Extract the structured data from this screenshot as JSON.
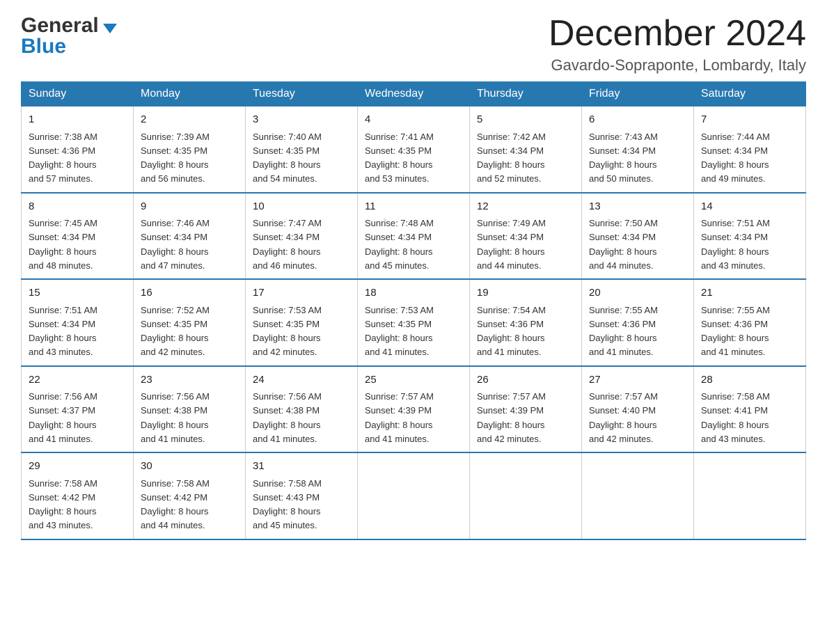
{
  "header": {
    "logo_general": "General",
    "logo_blue": "Blue",
    "month_title": "December 2024",
    "location": "Gavardo-Sopraponte, Lombardy, Italy"
  },
  "days_of_week": [
    "Sunday",
    "Monday",
    "Tuesday",
    "Wednesday",
    "Thursday",
    "Friday",
    "Saturday"
  ],
  "weeks": [
    [
      {
        "day": "1",
        "sunrise": "7:38 AM",
        "sunset": "4:36 PM",
        "daylight": "8 hours and 57 minutes."
      },
      {
        "day": "2",
        "sunrise": "7:39 AM",
        "sunset": "4:35 PM",
        "daylight": "8 hours and 56 minutes."
      },
      {
        "day": "3",
        "sunrise": "7:40 AM",
        "sunset": "4:35 PM",
        "daylight": "8 hours and 54 minutes."
      },
      {
        "day": "4",
        "sunrise": "7:41 AM",
        "sunset": "4:35 PM",
        "daylight": "8 hours and 53 minutes."
      },
      {
        "day": "5",
        "sunrise": "7:42 AM",
        "sunset": "4:34 PM",
        "daylight": "8 hours and 52 minutes."
      },
      {
        "day": "6",
        "sunrise": "7:43 AM",
        "sunset": "4:34 PM",
        "daylight": "8 hours and 50 minutes."
      },
      {
        "day": "7",
        "sunrise": "7:44 AM",
        "sunset": "4:34 PM",
        "daylight": "8 hours and 49 minutes."
      }
    ],
    [
      {
        "day": "8",
        "sunrise": "7:45 AM",
        "sunset": "4:34 PM",
        "daylight": "8 hours and 48 minutes."
      },
      {
        "day": "9",
        "sunrise": "7:46 AM",
        "sunset": "4:34 PM",
        "daylight": "8 hours and 47 minutes."
      },
      {
        "day": "10",
        "sunrise": "7:47 AM",
        "sunset": "4:34 PM",
        "daylight": "8 hours and 46 minutes."
      },
      {
        "day": "11",
        "sunrise": "7:48 AM",
        "sunset": "4:34 PM",
        "daylight": "8 hours and 45 minutes."
      },
      {
        "day": "12",
        "sunrise": "7:49 AM",
        "sunset": "4:34 PM",
        "daylight": "8 hours and 44 minutes."
      },
      {
        "day": "13",
        "sunrise": "7:50 AM",
        "sunset": "4:34 PM",
        "daylight": "8 hours and 44 minutes."
      },
      {
        "day": "14",
        "sunrise": "7:51 AM",
        "sunset": "4:34 PM",
        "daylight": "8 hours and 43 minutes."
      }
    ],
    [
      {
        "day": "15",
        "sunrise": "7:51 AM",
        "sunset": "4:34 PM",
        "daylight": "8 hours and 43 minutes."
      },
      {
        "day": "16",
        "sunrise": "7:52 AM",
        "sunset": "4:35 PM",
        "daylight": "8 hours and 42 minutes."
      },
      {
        "day": "17",
        "sunrise": "7:53 AM",
        "sunset": "4:35 PM",
        "daylight": "8 hours and 42 minutes."
      },
      {
        "day": "18",
        "sunrise": "7:53 AM",
        "sunset": "4:35 PM",
        "daylight": "8 hours and 41 minutes."
      },
      {
        "day": "19",
        "sunrise": "7:54 AM",
        "sunset": "4:36 PM",
        "daylight": "8 hours and 41 minutes."
      },
      {
        "day": "20",
        "sunrise": "7:55 AM",
        "sunset": "4:36 PM",
        "daylight": "8 hours and 41 minutes."
      },
      {
        "day": "21",
        "sunrise": "7:55 AM",
        "sunset": "4:36 PM",
        "daylight": "8 hours and 41 minutes."
      }
    ],
    [
      {
        "day": "22",
        "sunrise": "7:56 AM",
        "sunset": "4:37 PM",
        "daylight": "8 hours and 41 minutes."
      },
      {
        "day": "23",
        "sunrise": "7:56 AM",
        "sunset": "4:38 PM",
        "daylight": "8 hours and 41 minutes."
      },
      {
        "day": "24",
        "sunrise": "7:56 AM",
        "sunset": "4:38 PM",
        "daylight": "8 hours and 41 minutes."
      },
      {
        "day": "25",
        "sunrise": "7:57 AM",
        "sunset": "4:39 PM",
        "daylight": "8 hours and 41 minutes."
      },
      {
        "day": "26",
        "sunrise": "7:57 AM",
        "sunset": "4:39 PM",
        "daylight": "8 hours and 42 minutes."
      },
      {
        "day": "27",
        "sunrise": "7:57 AM",
        "sunset": "4:40 PM",
        "daylight": "8 hours and 42 minutes."
      },
      {
        "day": "28",
        "sunrise": "7:58 AM",
        "sunset": "4:41 PM",
        "daylight": "8 hours and 43 minutes."
      }
    ],
    [
      {
        "day": "29",
        "sunrise": "7:58 AM",
        "sunset": "4:42 PM",
        "daylight": "8 hours and 43 minutes."
      },
      {
        "day": "30",
        "sunrise": "7:58 AM",
        "sunset": "4:42 PM",
        "daylight": "8 hours and 44 minutes."
      },
      {
        "day": "31",
        "sunrise": "7:58 AM",
        "sunset": "4:43 PM",
        "daylight": "8 hours and 45 minutes."
      },
      null,
      null,
      null,
      null
    ]
  ],
  "labels": {
    "sunrise": "Sunrise:",
    "sunset": "Sunset:",
    "daylight": "Daylight:"
  }
}
